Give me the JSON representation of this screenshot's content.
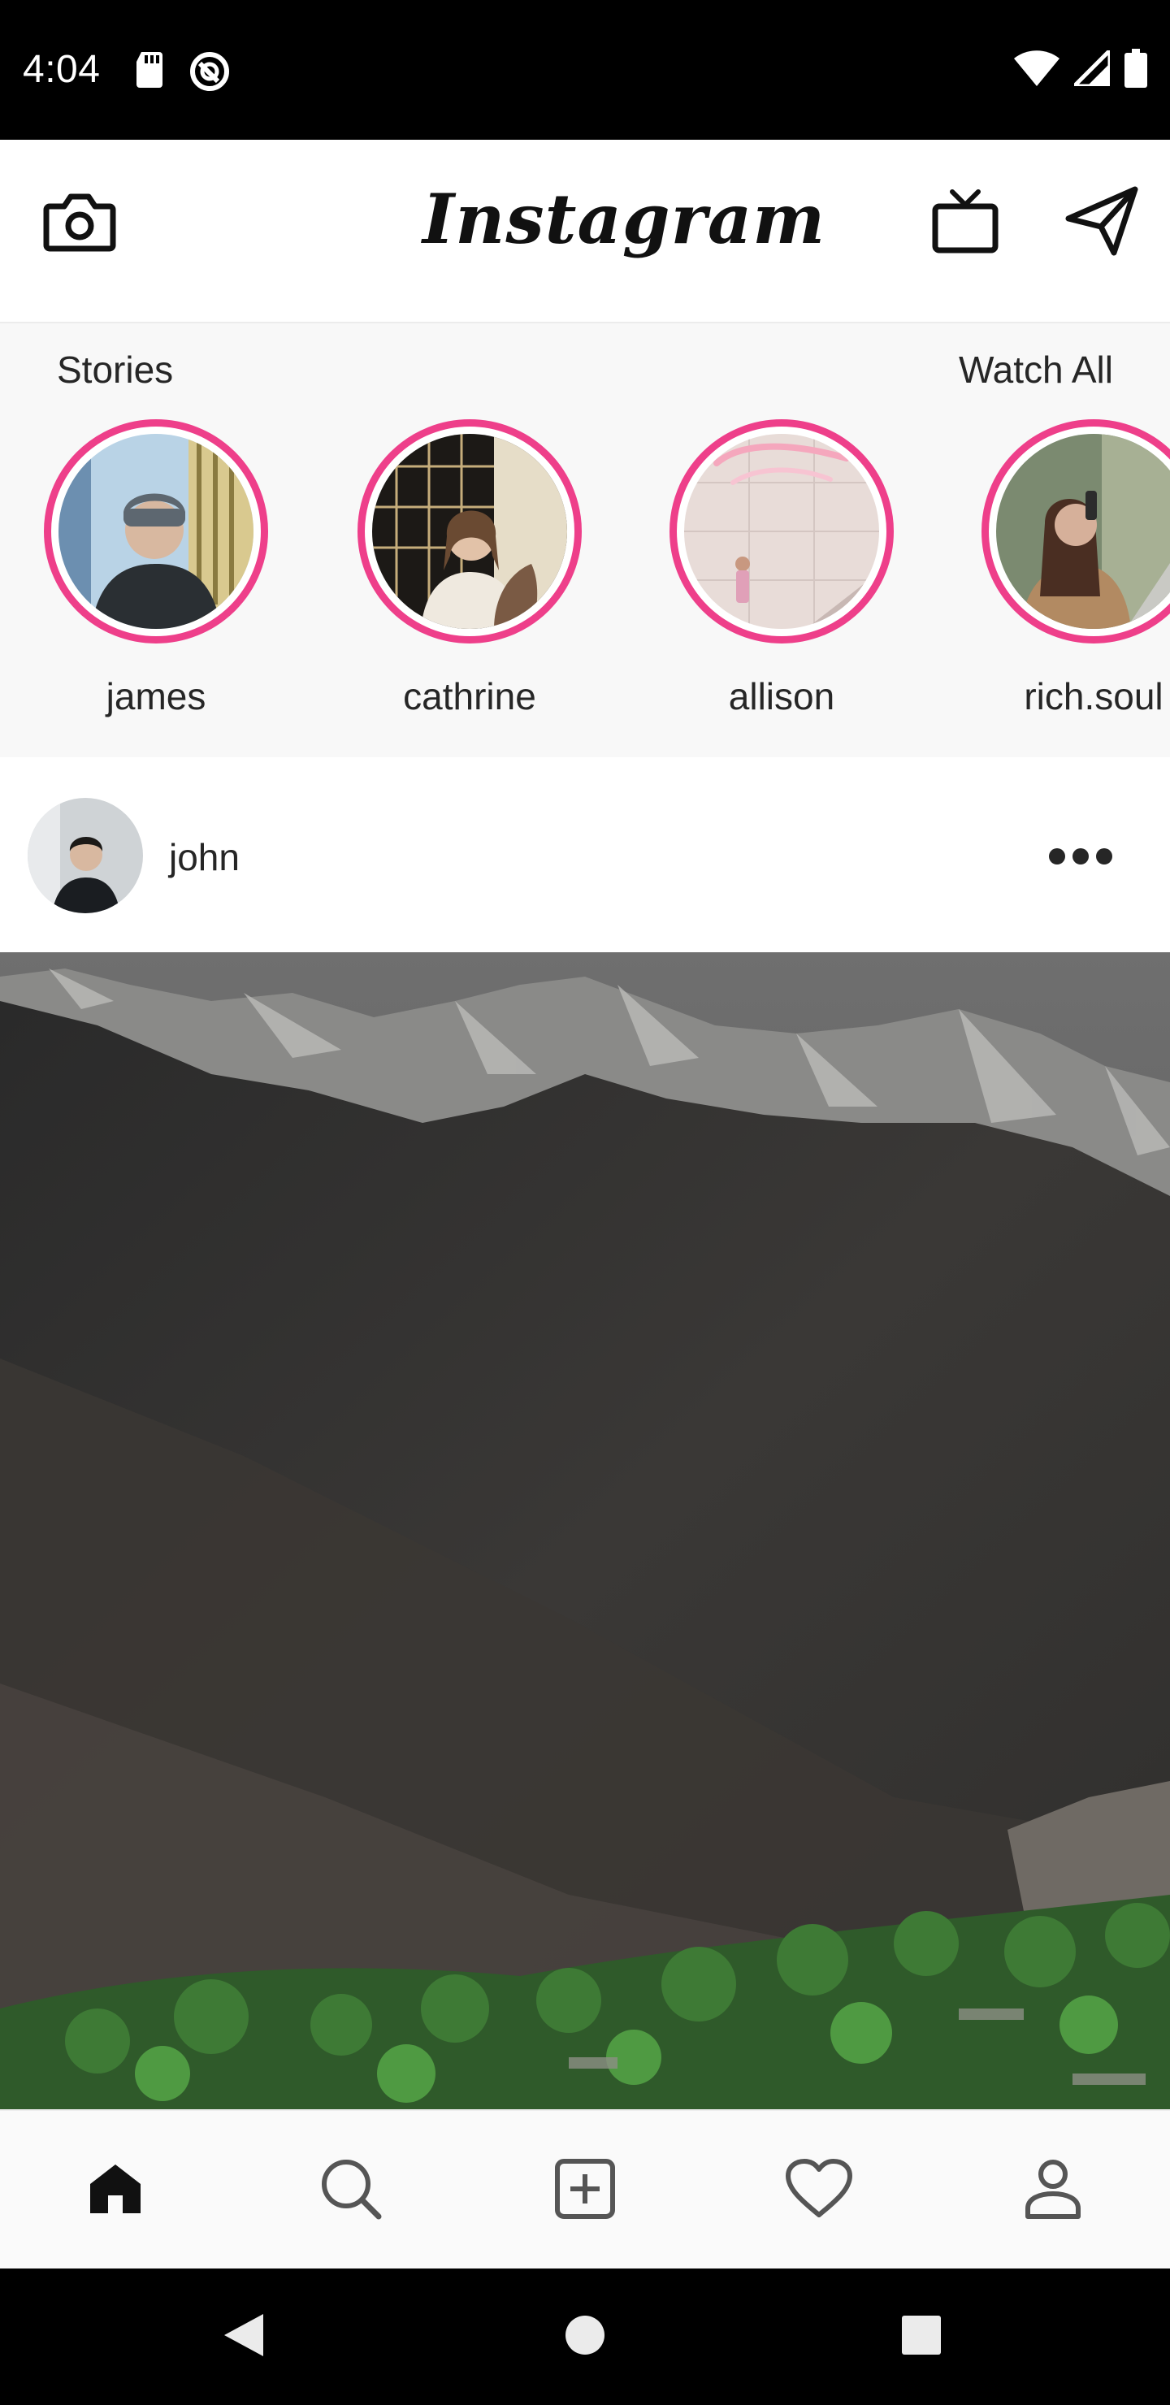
{
  "status_bar": {
    "time": "4:04",
    "icons": [
      "sd-card-icon",
      "do-not-disturb-icon",
      "wifi-icon",
      "cellular-icon",
      "battery-icon"
    ]
  },
  "header": {
    "logo_text": "Instagram",
    "left_icon": "camera-icon",
    "right_icons": [
      "tv-icon",
      "send-icon"
    ]
  },
  "stories": {
    "title": "Stories",
    "watch_all": "Watch All",
    "items": [
      {
        "name": "james"
      },
      {
        "name": "cathrine"
      },
      {
        "name": "allison"
      },
      {
        "name": "rich.soul"
      }
    ],
    "ring_color": "#ee3f8a"
  },
  "post": {
    "username": "john",
    "more_icon": "more-dots-icon"
  },
  "bottom_nav": {
    "items": [
      "home-icon",
      "search-icon",
      "add-post-icon",
      "heart-icon",
      "profile-icon"
    ],
    "active": "home-icon"
  },
  "system_nav": {
    "items": [
      "back-icon",
      "home-circle-icon",
      "recents-icon"
    ]
  }
}
